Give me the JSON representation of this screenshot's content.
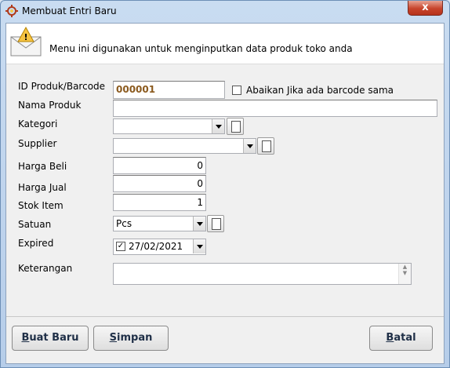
{
  "window": {
    "title": "Membuat Entri Baru",
    "close_label": "x"
  },
  "header": {
    "text": "Menu ini digunakan untuk menginputkan data produk toko anda"
  },
  "form": {
    "id_label": "ID Produk/Barcode",
    "id_value": "000001",
    "ignore_barcode_label": "Abaikan Jika ada barcode sama",
    "nama_label": "Nama Produk",
    "nama_value": "",
    "kategori_label": "Kategori",
    "kategori_value": "",
    "supplier_label": "Supplier",
    "supplier_value": "",
    "harga_beli_label": "Harga Beli",
    "harga_beli_value": "0",
    "harga_jual_label": "Harga Jual",
    "harga_jual_value": "0",
    "stok_label": "Stok Item",
    "stok_value": "1",
    "satuan_label": "Satuan",
    "satuan_value": "Pcs",
    "expired_label": "Expired",
    "expired_value": "27/02/2021",
    "keterangan_label": "Keterangan",
    "keterangan_value": ""
  },
  "buttons": {
    "buat_baru_first": "B",
    "buat_baru_rest": "uat Baru",
    "simpan_first": "S",
    "simpan_rest": "impan",
    "batal_first": "B",
    "batal_rest": "atal"
  },
  "icons": {
    "title": "gear-warning-icon",
    "header": "envelope-warning-icon"
  },
  "colors": {
    "code_text": "#8b5a1e",
    "close_button": "#c7442b",
    "button_text": "#1f2f47"
  }
}
